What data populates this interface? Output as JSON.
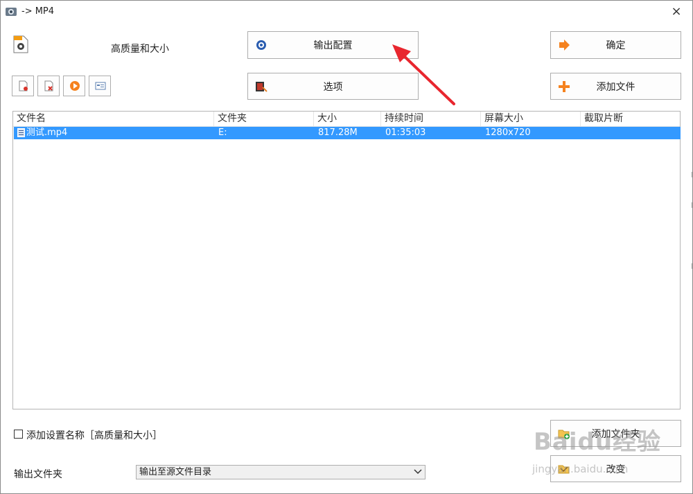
{
  "window": {
    "title": "-> MP4",
    "close": "×"
  },
  "profile": {
    "label": "高质量和大小"
  },
  "buttons": {
    "output_config": "输出配置",
    "options": "选项",
    "ok": "确定",
    "add_file": "添加文件",
    "add_folder": "添加文件夹",
    "change": "改变"
  },
  "table": {
    "columns": [
      "文件名",
      "文件夹",
      "大小",
      "持续时间",
      "屏幕大小",
      "截取片断"
    ],
    "rows": [
      {
        "name": "测试.mp4",
        "folder": "E:",
        "size": "817.28M",
        "duration": "01:35:03",
        "resolution": "1280x720",
        "clip": ""
      }
    ]
  },
  "settings": {
    "add_name_label": "添加设置名称［高质量和大小］",
    "output_folder_label": "输出文件夹",
    "output_folder_value": "输出至源文件目录"
  },
  "watermark": {
    "brand": "Baidu经验",
    "url": "jingyan.baidu.com"
  },
  "colors": {
    "selection": "#3399ff",
    "arrow": "#e8262e",
    "orange": "#f5821f"
  }
}
